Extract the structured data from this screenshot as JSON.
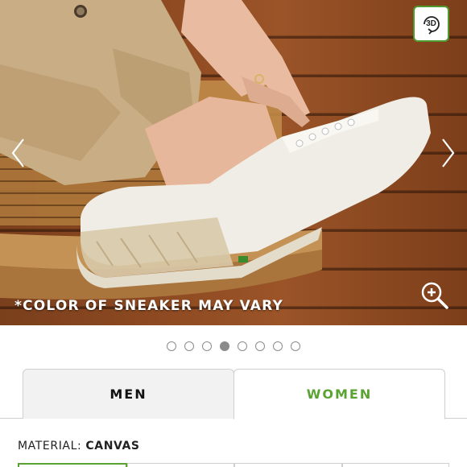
{
  "hero": {
    "caption": "*COLOR OF SNEAKER MAY VARY",
    "badge_3d_label": "3D",
    "icons": [
      "chevron-left-icon",
      "chevron-right-icon",
      "zoom-in-icon",
      "rotate-3d-icon"
    ]
  },
  "carousel": {
    "dot_count": 8,
    "active_index": 3
  },
  "gender_tabs": [
    {
      "label": "MEN",
      "selected": false
    },
    {
      "label": "WOMEN",
      "selected": true
    }
  ],
  "material": {
    "key": "MATERIAL:",
    "value": "CANVAS"
  },
  "colors": {
    "accent": "#5aa333",
    "badge_border": "#4f9a2e",
    "wood": "#8e4a22"
  }
}
